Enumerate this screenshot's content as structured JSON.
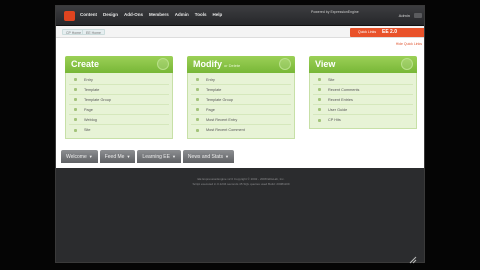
{
  "topbar": {
    "nav": [
      "Content",
      "Design",
      "Add-Ons",
      "Members",
      "Admin",
      "Tools",
      "Help"
    ],
    "powered_by": "Powered by  ExpressionEngine",
    "user": "Admin"
  },
  "breadcrumbs": [
    "CP Home",
    "EE Home"
  ],
  "quick_links": {
    "label": "Quick Links",
    "site": "EE 2.0"
  },
  "panel_link": "Hide Quick Links",
  "columns": [
    {
      "title": "Create",
      "subtitle": "",
      "items": [
        "Entry",
        "Template",
        "Template Group",
        "Page",
        "Weblog",
        "Site"
      ]
    },
    {
      "title": "Modify",
      "subtitle": "or Delete",
      "items": [
        "Entry",
        "Template",
        "Template Group",
        "Page",
        "Most Recent Entry",
        "Most Recent Comment"
      ]
    },
    {
      "title": "View",
      "subtitle": "",
      "items": [
        "Site",
        "Recent Comments",
        "Recent Entries",
        "User Guide",
        "CP Hits"
      ]
    }
  ],
  "tabs": [
    "Welcome",
    "Feed Me",
    "Learning EE",
    "News and Stats"
  ],
  "tab_arrow": "▼",
  "footer": {
    "line1": "EE ExpressionEngine v2.0 Copyright © 2002 - 2008  EllisLab, Inc.",
    "line2": "Script executed in 0.1234 seconds   45 SQL queries used   Build: 20081109"
  }
}
